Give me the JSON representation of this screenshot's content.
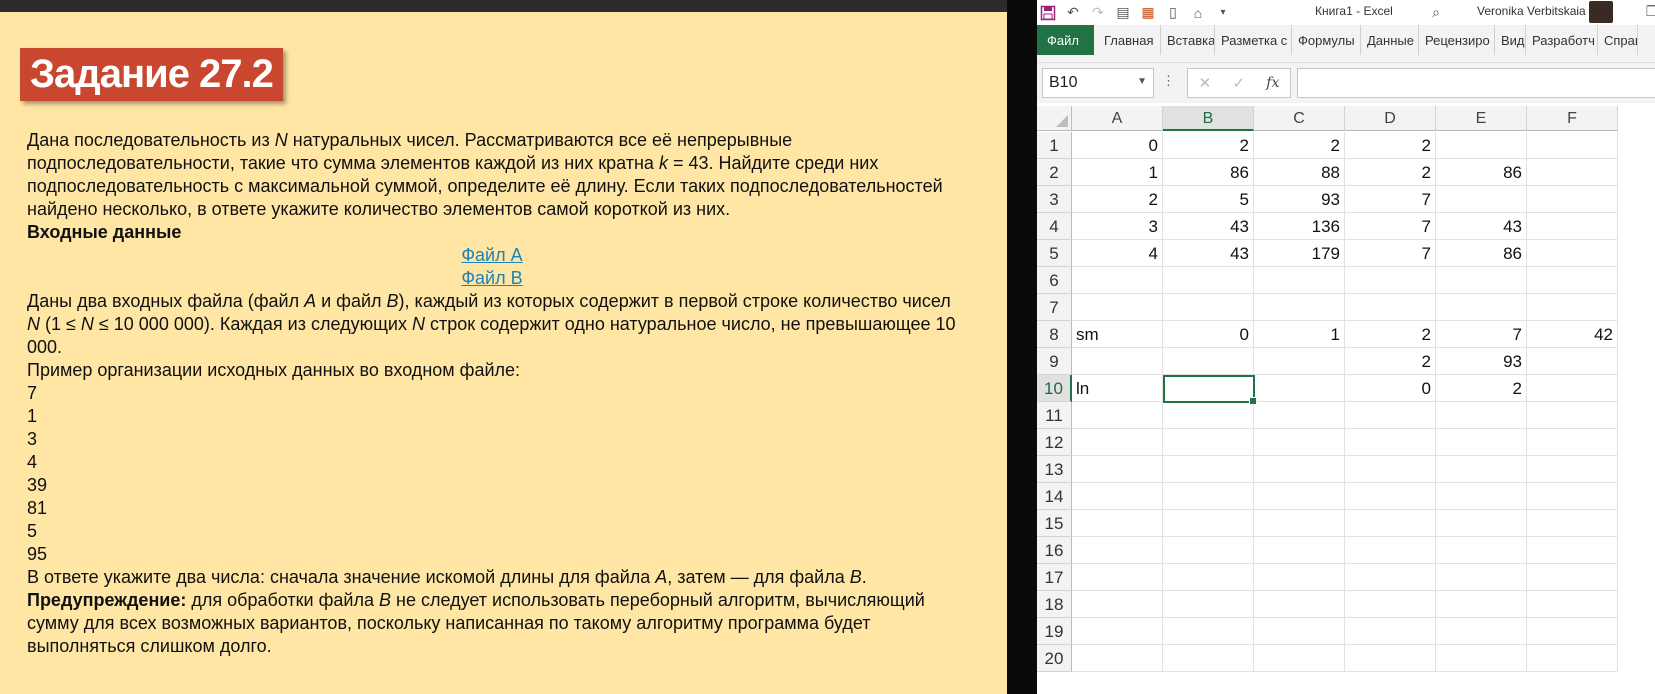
{
  "task": {
    "title": "Задание 27.2",
    "p1_a": "Дана последовательность из ",
    "p1_n": "N",
    "p1_b": " натуральных чисел. Рассматриваются все её непрерывные подпоследовательности, такие что сумма элементов каждой из них кратна ",
    "p1_k": "k",
    "p1_c": " = 43. Найдите среди них подпоследовательность с максимальной суммой, определите её длину. Если таких подпоследовательностей найдено несколько, в ответе укажите количество элементов самой короткой из них.",
    "input_heading": "Входные данные",
    "file_a_link": "Файл A",
    "file_b_link": "Файл B",
    "p2_a": "Даны два входных файла (файл ",
    "p2_A": "A",
    "p2_b": " и файл ",
    "p2_B": "B",
    "p2_c": "), каждый из которых содержит в первой строке количество чисел ",
    "p2_N1": "N",
    "p2_d": " (1 ≤ ",
    "p2_N2": "N",
    "p2_e": " ≤ 10 000 000). Каждая из следующих ",
    "p2_N3": "N",
    "p2_f": " строк содержит одно натуральное число, не превышающее 10 000.",
    "example_heading": "Пример организации исходных данных во входном файле:",
    "example_values": [
      "7",
      "1",
      "3",
      "4",
      "39",
      "81",
      "5",
      "95"
    ],
    "answer_a": "В ответе укажите два числа: сначала значение искомой длины для файла ",
    "answer_A": "A",
    "answer_b": ", затем — для файла ",
    "answer_B": "B",
    "answer_c": ".",
    "warning_label": "Предупреждение:",
    "warning_a": " для обработки файла ",
    "warning_B": "B",
    "warning_b": " не следует использовать переборный алгоритм, вычисляющий сумму для всех возможных вариантов, поскольку написанная по такому алгоритму программа будет выполняться слишком долго."
  },
  "excel": {
    "book_title": "Книга1  -  Excel",
    "user_name": "Veronika Verbitskaia",
    "tabs": [
      "Файл",
      "Главная",
      "Вставка",
      "Разметка с",
      "Формулы",
      "Данные",
      "Рецензиро",
      "Вид",
      "Разработч",
      "Справ"
    ],
    "name_box": "B10",
    "columns": [
      "A",
      "B",
      "C",
      "D",
      "E",
      "F"
    ],
    "rows": [
      "1",
      "2",
      "3",
      "4",
      "5",
      "6",
      "7",
      "8",
      "9",
      "10",
      "11",
      "12",
      "13",
      "14",
      "15",
      "16",
      "17",
      "18",
      "19",
      "20"
    ],
    "selected_column": "B",
    "selected_row": "10",
    "cells": {
      "1": {
        "A": "0",
        "B": "2",
        "C": "2",
        "D": "2"
      },
      "2": {
        "A": "1",
        "B": "86",
        "C": "88",
        "D": "2",
        "E": "86"
      },
      "3": {
        "A": "2",
        "B": "5",
        "C": "93",
        "D": "7"
      },
      "4": {
        "A": "3",
        "B": "43",
        "C": "136",
        "D": "7",
        "E": "43"
      },
      "5": {
        "A": "4",
        "B": "43",
        "C": "179",
        "D": "7",
        "E": "86"
      },
      "8": {
        "A": "sm",
        "B": "0",
        "C": "1",
        "D": "2",
        "E": "7",
        "F": "42"
      },
      "9": {
        "D": "2",
        "E": "93"
      },
      "10": {
        "A": "ln",
        "D": "0",
        "E": "2"
      }
    }
  }
}
